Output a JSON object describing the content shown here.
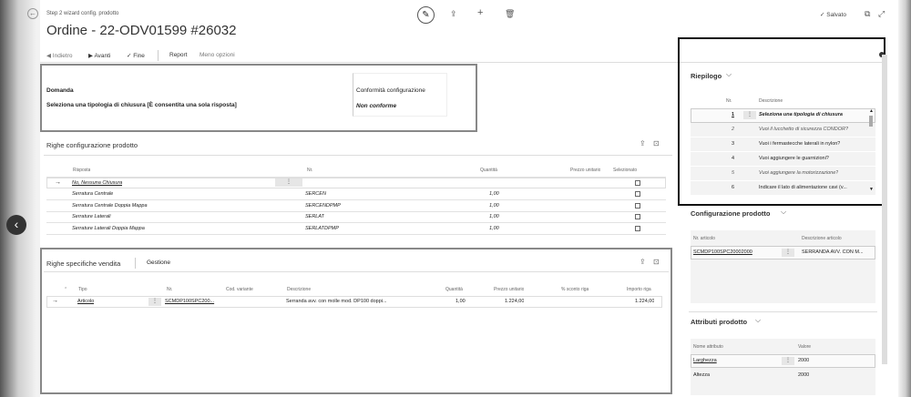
{
  "header": {
    "breadcrumb": "Step 2 wizard config. prodotto",
    "title": "Ordine - 22-ODV01599 #26032",
    "saved": "✓ Salvato"
  },
  "toolbar": {
    "back": "◀ Indietro",
    "next": "▶ Avanti",
    "finish": "✓ Fine",
    "report": "Report",
    "less": "Meno opzioni"
  },
  "question": {
    "domanda_label": "Domanda",
    "domanda_value": "Seleziona una tipologia di chiusura [È consentita una sola risposta]",
    "conf_label": "Conformità configurazione",
    "conf_value": "Non conforme"
  },
  "config_lines": {
    "title": "Righe configurazione prodotto",
    "columns": [
      "Risposta",
      "Nr.",
      "Quantità",
      "Prezzo unitario",
      "Selezionato"
    ],
    "rows": [
      {
        "risposta": "No, Nessuna Chiusura",
        "nr": "",
        "qty": ""
      },
      {
        "risposta": "Serratura Centrale",
        "nr": "SERCEN",
        "qty": "1,00"
      },
      {
        "risposta": "Serratura Centrale Doppia Mappa",
        "nr": "SERCENDPMP",
        "qty": "1,00"
      },
      {
        "risposta": "Serrature Laterali",
        "nr": "SERLAT",
        "qty": "1,00"
      },
      {
        "risposta": "Serrature Laterali Doppia Mappa",
        "nr": "SERLATDPMP",
        "qty": "1,00"
      }
    ]
  },
  "sales_lines": {
    "title": "Righe specifiche vendita",
    "tab": "Gestione",
    "columns": [
      "Tipo",
      "Nr.",
      "Cod. variante",
      "Descrizione",
      "Quantità",
      "Prezzo unitario",
      "% sconto riga",
      "Importo riga"
    ],
    "row": {
      "tipo": "Articolo",
      "nr": "SCMDP100SPC200...",
      "desc": "Serranda avv. con molle mod. DP100 doppi...",
      "qty": "1,00",
      "price": "1.224,00",
      "amount": "1.224,00"
    }
  },
  "summary": {
    "title": "Riepilogo",
    "col_nr": "Nr.",
    "col_desc": "Descrizione",
    "rows": [
      {
        "nr": "1",
        "desc": "Seleziona una tipologia di chiusura"
      },
      {
        "nr": "2",
        "desc": "Vuoi il lucchetto di sicurezza CONDOR?"
      },
      {
        "nr": "3",
        "desc": "Vuoi i fermastecche laterali in nylon?"
      },
      {
        "nr": "4",
        "desc": "Vuoi aggiungere le guarnizioni?"
      },
      {
        "nr": "5",
        "desc": "Vuoi aggiungere la motorizzazione?"
      },
      {
        "nr": "6",
        "desc": "Indicare il lato di alimentazione cavi (v..."
      }
    ]
  },
  "product_config": {
    "title": "Configurazione prodotto",
    "col_item": "Nr. articolo",
    "col_desc": "Descrizione articolo",
    "item": "SCMDP100SPC20002000",
    "desc": "SERRANDA AVV. CON M..."
  },
  "attributes": {
    "title": "Attributi prodotto",
    "col_name": "Nome attributo",
    "col_value": "Valore",
    "rows": [
      {
        "name": "Larghezza",
        "value": "2000"
      },
      {
        "name": "Altezza",
        "value": "2000"
      }
    ]
  }
}
